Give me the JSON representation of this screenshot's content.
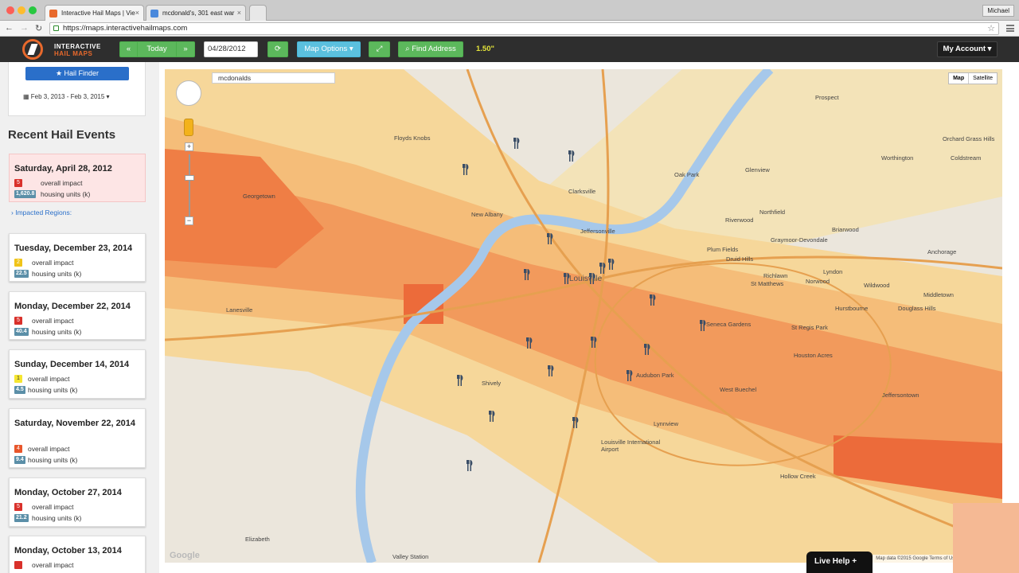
{
  "browser": {
    "tabs": [
      {
        "label": "Interactive Hail Maps | Vie",
        "active": true
      },
      {
        "label": "mcdonald's, 301 east war",
        "active": false
      }
    ],
    "user": "Michael",
    "url": "https://maps.interactivehailmaps.com"
  },
  "appbar": {
    "logo_line1": "INTERACTIVE",
    "logo_line2": "HAIL MAPS",
    "prev_icon": "«",
    "today_label": "Today",
    "next_icon": "»",
    "date_value": "04/28/2012",
    "refresh_icon": "⟳",
    "map_options_label": "Map Options ▾",
    "expand_icon": "⤢",
    "find_address_label": "Find Address",
    "hail_size": "1.50\"",
    "account_label": "My Account ▾"
  },
  "sidebar": {
    "hail_finder_label": "★ Hail Finder",
    "date_range": "Feb 3, 2013 - Feb 3, 2015 ▾",
    "recent_title": "Recent Hail Events",
    "impacted_regions": "Impacted Regions:",
    "impact_label": "overall impact",
    "housing_label": "housing units (k)",
    "events": [
      {
        "date": "Saturday, April 28, 2012",
        "severity": "5",
        "housing": "1,620.8",
        "sev_color": "#d9312b"
      },
      {
        "date": "Tuesday, December 23, 2014",
        "severity": "2",
        "housing": "22.5",
        "sev_color": "#f0c419"
      },
      {
        "date": "Monday, December 22, 2014",
        "severity": "5",
        "housing": "40.4",
        "sev_color": "#d9312b"
      },
      {
        "date": "Sunday, December 14, 2014",
        "severity": "1",
        "housing": "4.5",
        "sev_color": "#f5e630"
      },
      {
        "date": "Saturday, November 22, 2014",
        "severity": "4",
        "housing": "9.4",
        "sev_color": "#e8562b"
      },
      {
        "date": "Monday, October 27, 2014",
        "severity": "5",
        "housing": "21.2",
        "sev_color": "#d9312b"
      },
      {
        "date": "Monday, October 13, 2014",
        "severity": "",
        "housing": "",
        "sev_color": "#d9312b"
      }
    ]
  },
  "map": {
    "search_value": "mcdonalds",
    "type_map": "Map",
    "type_satellite": "Satellite",
    "footer": "Map data ©2015 Google   Terms of Use   Report a map error",
    "watermark": "Google",
    "zoom_in": "+",
    "zoom_out": "−",
    "places": [
      "Floyds Knobs",
      "Clarksville",
      "Jeffersonville",
      "New Albany",
      "Louisville",
      "Oak Park",
      "Glenview",
      "Prospect",
      "Orchard Grass Hills",
      "Worthington",
      "Coldstream",
      "Northfield",
      "Riverwood",
      "Briarwood",
      "Graymoor-Devondale",
      "Plum Fields",
      "Druid Hills",
      "Richlawn",
      "St Matthews",
      "Norwood",
      "Lyndon",
      "Anchorage",
      "Wildwood",
      "Middletown",
      "Hurstbourne",
      "Douglass Hills",
      "Seneca Gardens",
      "St Regis Park",
      "Houston Acres",
      "Audubon Park",
      "Shively",
      "West Buechel",
      "Jeffersontown",
      "Lynnview",
      "Louisville International Airport",
      "Hollow Creek",
      "Elizabeth",
      "Lanesville",
      "Valley Station",
      "Georgetown"
    ]
  },
  "live_help": "Live Help   +"
}
